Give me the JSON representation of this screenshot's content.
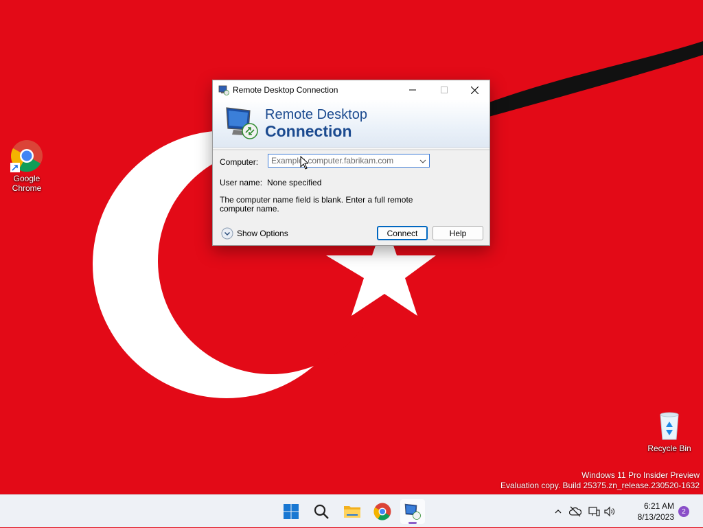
{
  "desktop": {
    "icons": [
      {
        "label_line1": "Google",
        "label_line2": "Chrome"
      },
      {
        "label": "Recycle Bin"
      }
    ],
    "watermark": {
      "line1": "Windows 11 Pro Insider Preview",
      "line2": "Evaluation copy. Build 25375.zn_release.230520-1632"
    },
    "colors": {
      "flag_red": "#e30a17",
      "flag_white": "#ffffff"
    }
  },
  "dialog": {
    "title": "Remote Desktop Connection",
    "banner_line1": "Remote Desktop",
    "banner_line2": "Connection",
    "computer_label": "Computer:",
    "computer_placeholder": "Example: computer.fabrikam.com",
    "computer_value": "",
    "username_label": "User name:",
    "username_value": "None specified",
    "message": "The computer name field is blank.  Enter a full remote computer name.",
    "show_options": "Show Options",
    "connect_label": "Connect",
    "help_label": "Help",
    "window_controls": [
      "minimize-icon",
      "maximize-icon",
      "close-icon"
    ]
  },
  "taskbar": {
    "pinned": [
      "windows-start-icon",
      "search-icon",
      "file-explorer-icon",
      "chrome-icon",
      "remote-desktop-icon"
    ],
    "active": "remote-desktop-icon",
    "tray_icons": [
      "chevron-up-icon",
      "cloud-offline-icon",
      "network-icon",
      "volume-icon"
    ],
    "time": "6:21 AM",
    "date": "8/13/2023",
    "notification_count": "2",
    "colors": {
      "accent": "#8b5fc7"
    }
  }
}
